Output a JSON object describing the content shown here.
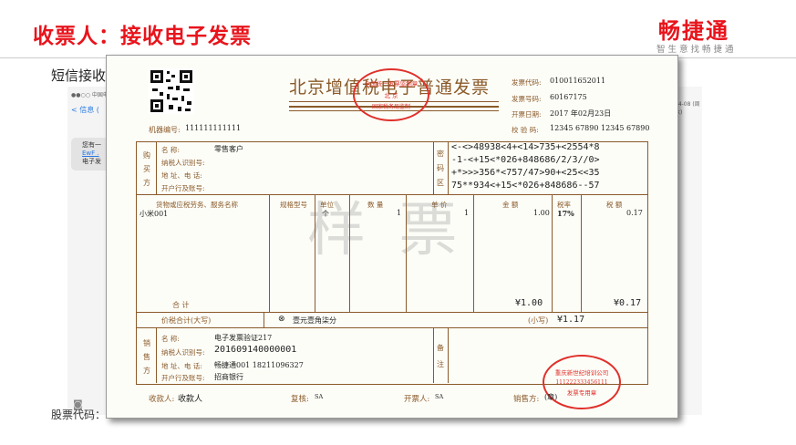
{
  "slide": {
    "title": "收票人：接收电子发票",
    "sms_label": "短信接收",
    "stock_label": "股票代码："
  },
  "brand": {
    "name": "畅捷通",
    "tagline": "智生意找畅捷通"
  },
  "phone": {
    "carrier": "●●○○ 中国电",
    "back": "< 信息 (",
    "msg1": "您有一",
    "msg2": "EwF .",
    "msg3": "电子发",
    "time": "04-08 (周六)"
  },
  "invoice": {
    "title": "北京增值税电子普通发票",
    "machine_label": "机器编号:",
    "machine_no": "111111111111",
    "code_label": "发票代码:",
    "code": "010011652011",
    "number_label": "发票号码:",
    "number": "60167175",
    "date_label": "开票日期:",
    "date": "2017 年02月23日",
    "check_label": "校 验 码:",
    "check": "12345 67890 12345 67890",
    "stamp_top": {
      "line1": "全国统一发票监制章",
      "line2": "北 京",
      "line3": "国家税务局监制"
    },
    "buyer": {
      "section": "购买方",
      "name_label": "名      称:",
      "name": "零售客户",
      "tax_label": "纳税人识别号:",
      "addr_label": "地 址、电 话:",
      "bank_label": "开户行及账号:"
    },
    "cipher": {
      "section": "密码区",
      "lines": [
        "<-<>48938<4+<14>735+<2554*8",
        "-1-<+15<*026+848686/2/3//0>",
        "+*>>>356*<757/47>90+<25<<35",
        "75**934<+15<*026+848686--57"
      ]
    },
    "items": {
      "col_name": "货物或应税劳务、服务名称",
      "col_spec": "规格型号",
      "col_unit": "单位",
      "col_qty": "数 量",
      "col_price": "单 价",
      "col_amount": "金 额",
      "col_rate": "税率",
      "col_tax": "税 额",
      "rows": [
        {
          "name": "小米001",
          "unit": "个",
          "qty": "1",
          "price": "1",
          "amount": "1.00",
          "rate": "17%",
          "tax": "0.17"
        }
      ],
      "total_label": "合        计",
      "total_amount": "¥1.00",
      "total_tax": "¥0.17"
    },
    "grand": {
      "label": "价税合计(大写)",
      "words": "壹元壹角柒分",
      "small_label": "(小写)",
      "small": "¥1.17"
    },
    "seller": {
      "section": "销售方",
      "name_label": "名      称:",
      "name": "电子发票验证217",
      "tax_label": "纳税人识别号:",
      "tax_id": "201609140000001",
      "addr_label": "地 址、电 话:",
      "addr": "畅捷通001 18211096327",
      "bank_label": "开户行及账号:",
      "bank": "招商银行",
      "remarks": "备注"
    },
    "stamp_seller": {
      "line1": "重庆新世纪培训公司",
      "line2": "111222333456111",
      "line3": "发票专用章"
    },
    "footer": {
      "payee_label": "收款人:",
      "payee": "收款人",
      "reviewer_label": "复核:",
      "reviewer": "SA",
      "issuer_label": "开票人:",
      "issuer": "SA",
      "seller_label": "销售方:",
      "seller_mark": "(章)"
    },
    "watermark": "样  票"
  }
}
